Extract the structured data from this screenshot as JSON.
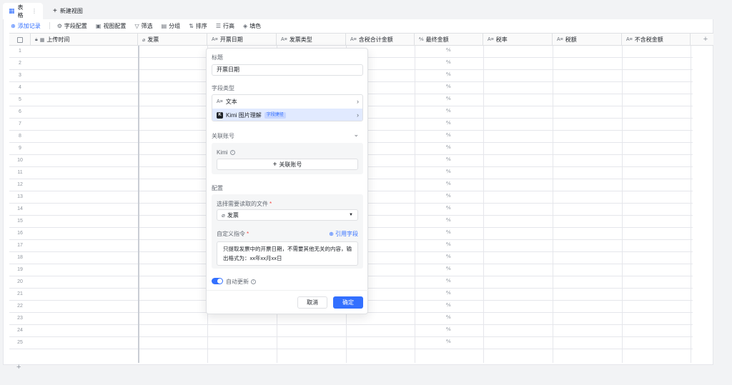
{
  "tabs": {
    "active_label": "表格",
    "new_view_label": "新建视图"
  },
  "toolbar": {
    "add_record": "添加记录",
    "field_config": "字段配置",
    "view_config": "视图配置",
    "filter": "筛选",
    "group": "分组",
    "sort": "排序",
    "row_height": "行高",
    "fill_color": "填色"
  },
  "columns": [
    {
      "label": "上传时间",
      "icon": "calendar-icon"
    },
    {
      "label": "发票",
      "icon": "attachment-icon"
    },
    {
      "label": "开票日期",
      "icon": "text-field-icon"
    },
    {
      "label": "发票类型",
      "icon": "text-field-icon"
    },
    {
      "label": "含税合计金额",
      "icon": "text-field-icon"
    },
    {
      "label": "最终金额",
      "icon": "formula-icon"
    },
    {
      "label": "税率",
      "icon": "text-field-icon"
    },
    {
      "label": "税额",
      "icon": "text-field-icon"
    },
    {
      "label": "不含税金额",
      "icon": "text-field-icon"
    }
  ],
  "rows": [
    "1",
    "2",
    "3",
    "4",
    "5",
    "6",
    "7",
    "8",
    "9",
    "10",
    "11",
    "12",
    "13",
    "14",
    "15",
    "16",
    "17",
    "18",
    "19",
    "20",
    "21",
    "22",
    "23",
    "24",
    "25"
  ],
  "panel": {
    "title_label": "标题",
    "title_value": "开票日期",
    "field_type_label": "字段类型",
    "type_text": "文本",
    "type_kimi": "Kimi 图片理解",
    "type_kimi_tag": "字段捷径",
    "linked_account_label": "关联账号",
    "kimi_label": "Kimi",
    "link_account_button": "关联账号",
    "config_label": "配置",
    "select_file_label": "选择需要读取的文件",
    "select_file_value": "发票",
    "custom_instruction_label": "自定义指令",
    "reference_field": "引用字段",
    "instruction_text": "只提取发票中的开票日期，不需要其他无关的内容，输出格式为：xx年xx月xx日",
    "auto_update_label": "自动更新",
    "cancel": "取消",
    "confirm": "确定"
  },
  "colors": {
    "accent": "#3370ff",
    "required": "#f54a45"
  }
}
